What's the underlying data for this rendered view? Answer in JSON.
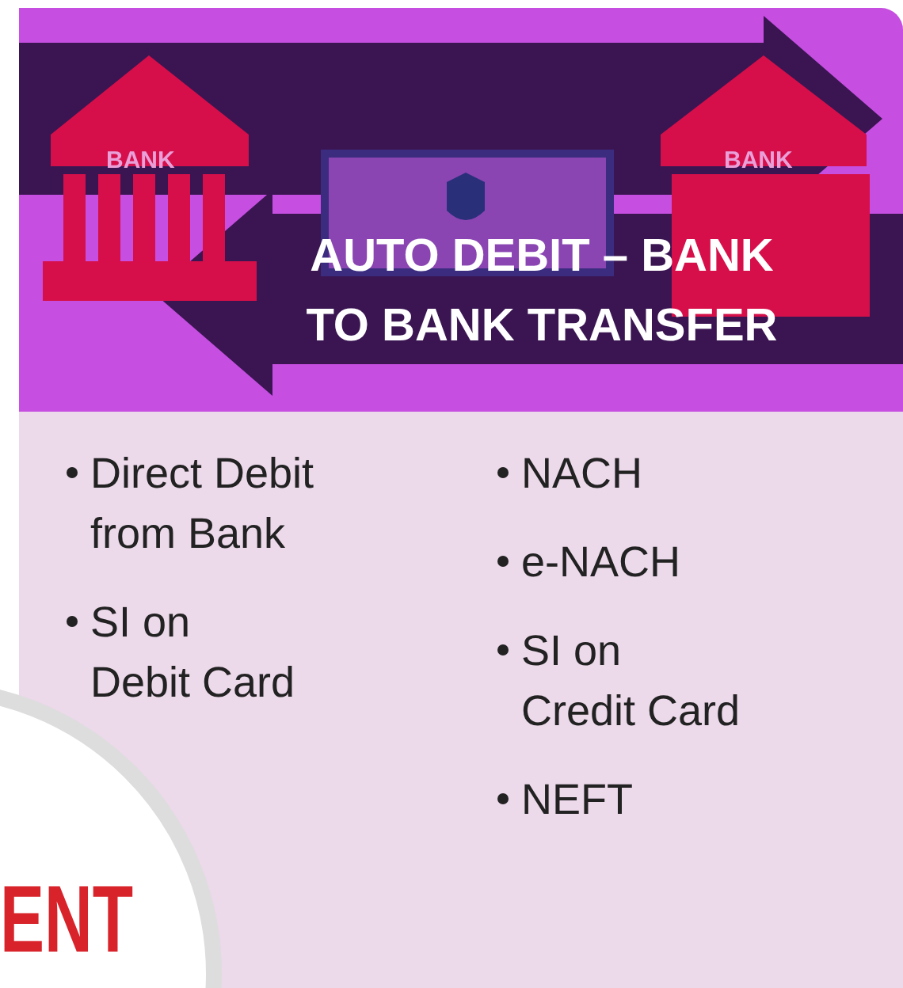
{
  "banner": {
    "title_lines": [
      "AUTO DEBIT – BANK",
      "TO BANK TRANSFER"
    ],
    "bank_labels": [
      "BANK",
      "BANK"
    ]
  },
  "columns": [
    {
      "items": [
        "Direct Debit\nfrom Bank",
        "SI on\nDebit Card"
      ]
    },
    {
      "items": [
        "NACH",
        "e-NACH",
        "SI on\nCredit Card",
        "NEFT"
      ]
    }
  ],
  "badge": {
    "text": "ENT"
  }
}
